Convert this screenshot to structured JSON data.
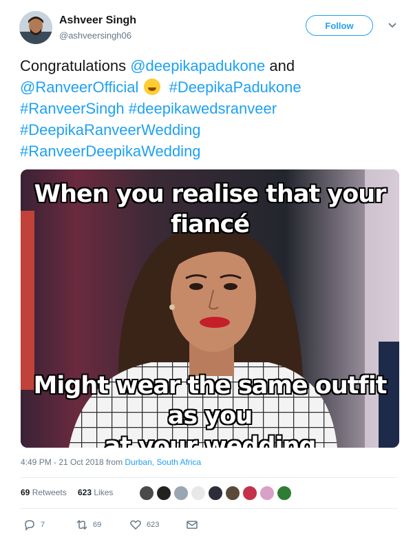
{
  "header": {
    "name": "Ashveer Singh",
    "handle": "@ashveersingh06",
    "follow_label": "Follow"
  },
  "tweet": {
    "congrats": "Congratulations ",
    "mention1": "@deepikapadukone",
    "and": " and",
    "mention2": "@RanveerOfficial",
    "emoji": "rolling-on-floor-laughing-emoji",
    "hashtags": {
      "h1": "#DeepikaPadukone",
      "h2": "#RanveerSingh",
      "h3": "#deepikawedsranveer",
      "h4": "#DeepikaRanveerWedding",
      "h5": "#RanveerDeepikaWedding"
    }
  },
  "meme": {
    "top_line1": "When you realise that your",
    "top_line2": "fiancé",
    "bottom_line1": "Might wear the same outfit as you",
    "bottom_line2": "at your wedding"
  },
  "meta": {
    "time": "4:49 PM - 21 Oct 2018 from ",
    "location": "Durban, South Africa"
  },
  "stats": {
    "retweets_count": "69",
    "retweets_label": "Retweets",
    "likes_count": "623",
    "likes_label": "Likes"
  },
  "actions": {
    "reply_count": "7",
    "retweet_count": "69",
    "like_count": "623"
  },
  "colors": {
    "link": "#1da1f2",
    "text": "#14171a",
    "muted": "#657786"
  }
}
